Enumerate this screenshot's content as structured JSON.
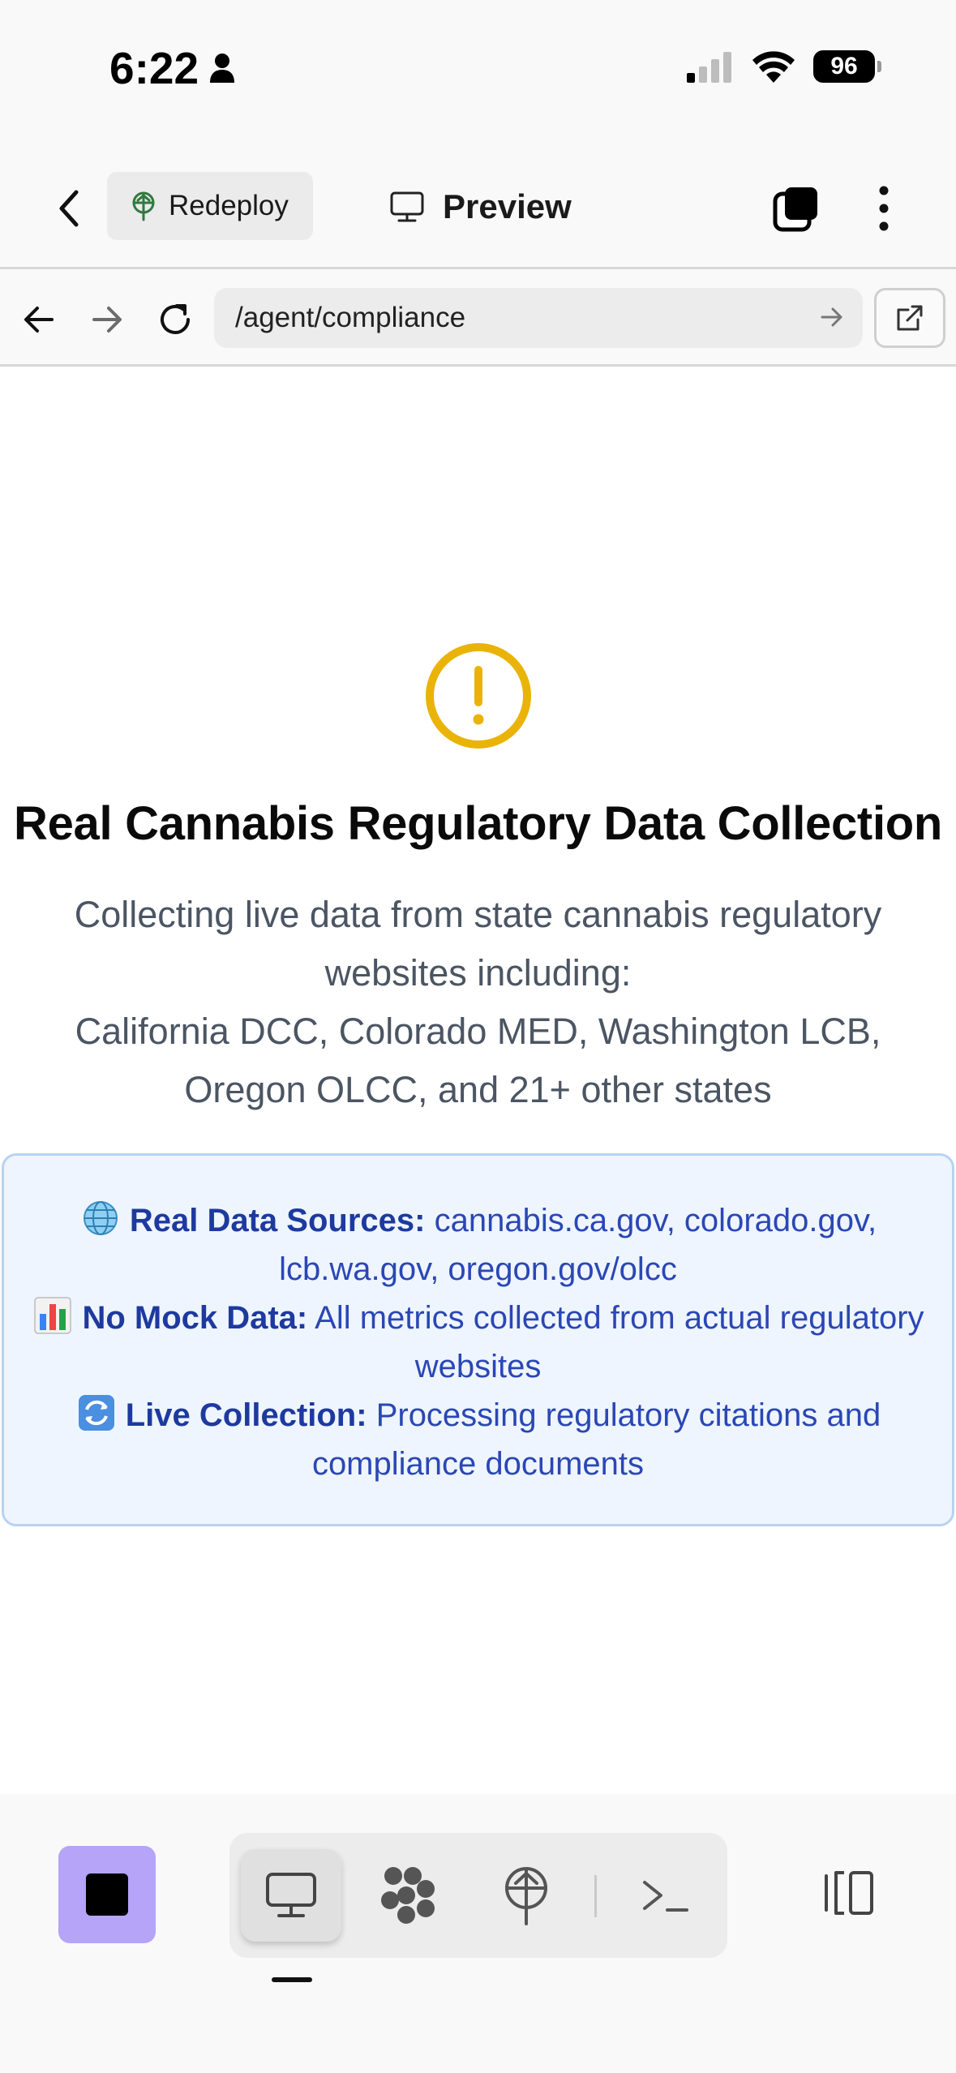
{
  "status_bar": {
    "time": "6:22",
    "battery": "96"
  },
  "header": {
    "redeploy_label": "Redeploy",
    "preview_label": "Preview"
  },
  "browser": {
    "url": "/agent/compliance"
  },
  "main": {
    "title": "Real Cannabis Regulatory Data Collection",
    "subtitle_line1": "Collecting live data from state cannabis regulatory websites including:",
    "subtitle_line2": "California DCC, Colorado MED, Washington LCB, Oregon OLCC, and 21+ other states",
    "info": [
      {
        "icon": "globe-icon",
        "label": "Real Data Sources:",
        "text": "cannabis.ca.gov, colorado.gov, lcb.wa.gov, oregon.gov/olcc"
      },
      {
        "icon": "bar-chart-icon",
        "label": "No Mock Data:",
        "text": "All metrics collected from actual regulatory websites"
      },
      {
        "icon": "refresh-icon",
        "label": "Live Collection:",
        "text": "Processing regulatory citations and compliance documents"
      }
    ]
  },
  "colors": {
    "accent_purple": "#b5a4f7",
    "warning_yellow": "#eab308",
    "info_bg": "#eef5ff",
    "info_border": "#b8d3f2",
    "info_text": "#2b47b5"
  }
}
